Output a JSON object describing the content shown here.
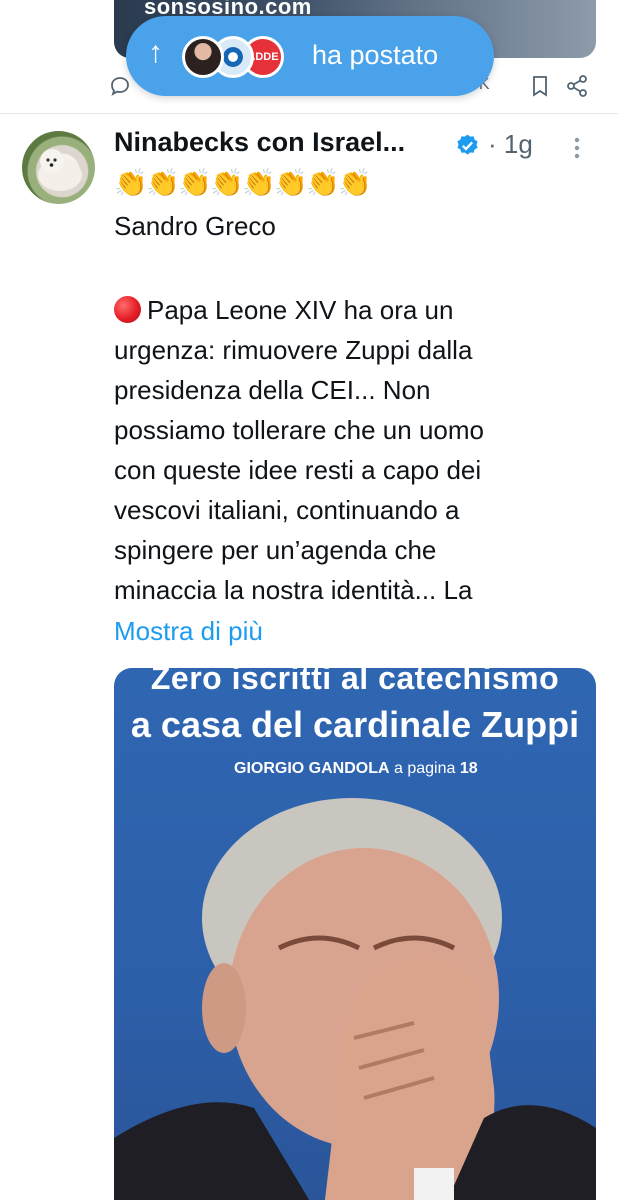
{
  "previous_tweet": {
    "media_caption": "sonsosino.com",
    "view_count": "5K"
  },
  "posted_pill": {
    "arrow": "↑",
    "badge_text": "ADDE",
    "label": "ha postato"
  },
  "tweet": {
    "author_name": "Ninabecks con Israel...",
    "dot": "·",
    "time": "1g",
    "emojis": [
      "👏",
      "👏",
      "👏",
      "👏",
      "👏",
      "👏",
      "👏",
      "👏"
    ],
    "line1": "Sandro Greco",
    "paragraph_lines": [
      "Papa Leone XIV ha ora un",
      "urgenza: rimuovere Zuppi dalla",
      "presidenza della CEI... Non",
      "possiamo tollerare che un uomo",
      "con queste idee resti a capo dei",
      "vescovi italiani, continuando a",
      "spingere per un’agenda che",
      "minaccia la nostra identità... La"
    ],
    "show_more": "Mostra di più"
  },
  "media": {
    "headline_1": "Zero iscritti al catechismo",
    "headline_2": "a casa del cardinale Zuppi",
    "author": "GIORGIO GANDOLA",
    "page_ref": "a pagina",
    "page_num": "18"
  },
  "colors": {
    "accent": "#1d9bf0",
    "pill": "#4aa3ea",
    "muted": "#536471",
    "media_bg": "#2f66b2"
  }
}
